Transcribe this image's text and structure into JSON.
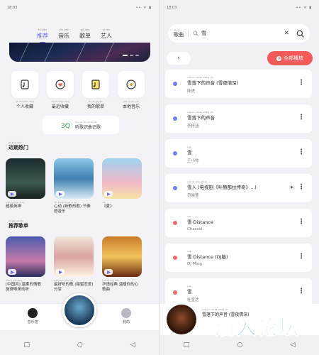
{
  "left": {
    "status_time": "18:03",
    "status_icons": "•• ᯤ ▮",
    "tabs": [
      {
        "label": "推荐",
        "pinyin": "tuī jiàn"
      },
      {
        "label": "音乐",
        "pinyin": "yīn yuè"
      },
      {
        "label": "歌单",
        "pinyin": "gē dān"
      },
      {
        "label": "艺人",
        "pinyin": "yì rén"
      }
    ],
    "quick": [
      {
        "label": "个人收藏",
        "pinyin": "gè rén shōu cáng",
        "icon": "music-note-icon"
      },
      {
        "label": "最近收藏",
        "pinyin": "zuì jìn shōu cáng",
        "icon": "heart-chat-icon"
      },
      {
        "label": "我的歌单",
        "pinyin": "wǒ de gē dān",
        "icon": "music-list-icon"
      },
      {
        "label": "本地音乐",
        "pinyin": "běn dì yīn yuè",
        "icon": "disc-icon"
      }
    ],
    "recognize": {
      "label": "听歌识曲识歌",
      "pinyin": "tīng gē shí qǔ shí gē"
    },
    "hot": {
      "title": "近期热门",
      "pinyin": "jìn qī rè mén",
      "items": [
        {
          "caption": "超级英雄",
          "pinyin": "chāo jí yīng xióng"
        },
        {
          "caption": "心动 (新歌热歌) 节奏感音乐",
          "pinyin": "xīn dòng xīn gē rè gē"
        },
        {
          "caption": "《夏》",
          "pinyin": "xià"
        }
      ]
    },
    "rec": {
      "title": "推荐歌单",
      "pinyin": "tuī jiàn gē dān",
      "items": [
        {
          "caption": "[中国风] 温柔的情歌 旋律唯美动听",
          "pinyin": "zhōng guó fēng"
        },
        {
          "caption": "最好听的歌 (甜蜜恋爱) 分享",
          "pinyin": "zuì hǎo tīng de gē"
        },
        {
          "caption": "华语经典 温暖你的心 歌曲",
          "pinyin": "huá yǔ jīng diǎn"
        }
      ]
    },
    "nav": [
      {
        "label": "音乐馆",
        "pinyin": "yīn yuè guǎn"
      },
      {
        "label": "我的",
        "pinyin": "wǒ de"
      }
    ]
  },
  "right": {
    "status_time": "18:03",
    "status_icons": "•• ᯤ ▮",
    "search": {
      "scope": "歌曲",
      "scope_pinyin": "gē qǔ",
      "query": "雪"
    },
    "play_all": "全部播放",
    "songs": [
      {
        "title": "雪落下的声音 (雪夜情深)",
        "pinyin": "xuě luò xià de shēng yīn",
        "artist": "陆虎",
        "dot": "#6f7ff0"
      },
      {
        "title": "雪落下的声音",
        "pinyin": "xuě luò xià de shēng yīn",
        "artist": "李梓涵",
        "dot": "#6f7ff0"
      },
      {
        "title": "雪",
        "pinyin": "xuě",
        "artist": "王小帅",
        "dot": "#6f7ff0"
      },
      {
        "title": "雪人 (电视剧《叶赫那拉传奇》...)",
        "pinyin": "xuě rén diàn shì jù",
        "artist": "范晓萱",
        "dot": "#6f7ff0"
      },
      {
        "title": "雪 Distance",
        "pinyin": "xuě",
        "artist": "Chassel",
        "dot": "#ef6a6a"
      },
      {
        "title": "雪 Distance (DJ版)",
        "pinyin": "xuě",
        "artist": "DJ Ming",
        "dot": "#ef6a6a"
      },
      {
        "title": "雪",
        "pinyin": "xuě",
        "artist": "杜宣达",
        "dot": "#ef6a6a"
      }
    ],
    "now_playing": {
      "title": "雪落下的声音 (雪夜情深)",
      "pinyin": "xuě luò xià de shēng yīn"
    },
    "watermark": "酒入论坛"
  }
}
